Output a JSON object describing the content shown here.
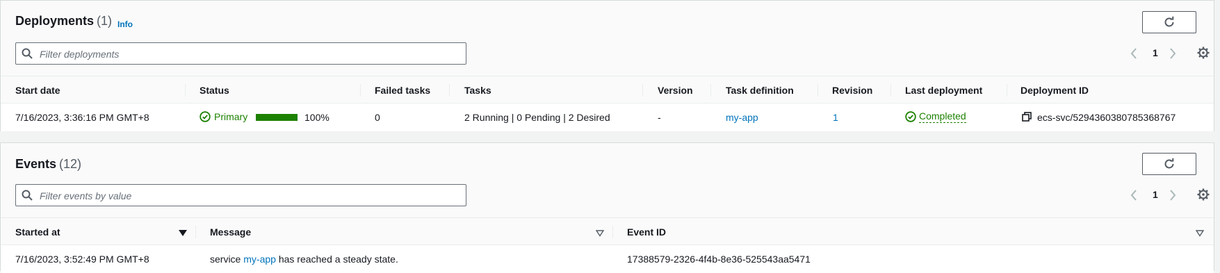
{
  "deployments": {
    "title": "Deployments",
    "count": "(1)",
    "info_label": "Info",
    "search_placeholder": "Filter deployments",
    "page": "1",
    "columns": [
      "Start date",
      "Status",
      "Failed tasks",
      "Tasks",
      "Version",
      "Task definition",
      "Revision",
      "Last deployment",
      "Deployment ID"
    ],
    "row": {
      "start_date": "7/16/2023, 3:36:16 PM GMT+8",
      "status": "Primary",
      "progress_label": "100%",
      "progress_fraction": 1.0,
      "failed_tasks": "0",
      "tasks": "2 Running | 0 Pending | 2 Desired",
      "version": "-",
      "task_definition": "my-app",
      "revision": "1",
      "last_deployment": "Completed",
      "deployment_id": "ecs-svc/5294360380785368767"
    }
  },
  "events": {
    "title": "Events",
    "count": "(12)",
    "search_placeholder": "Filter events by value",
    "page": "1",
    "columns": [
      "Started at",
      "Message",
      "Event ID"
    ],
    "row": {
      "started_at": "7/16/2023, 3:52:49 PM GMT+8",
      "message_prefix": "service",
      "message_link": "my-app",
      "message_suffix": "has reached a steady state.",
      "event_id": "17388579-2326-4f4b-8e36-525543aa5471"
    }
  },
  "colors": {
    "link": "#0073bb",
    "success": "#1d8102",
    "border": "#d5dbdb"
  },
  "icons": [
    "refresh-icon",
    "search-icon",
    "chevron-left-icon",
    "chevron-right-icon",
    "gear-icon",
    "check-circle-icon",
    "copy-icon",
    "sort-desc-icon",
    "sort-icon"
  ]
}
